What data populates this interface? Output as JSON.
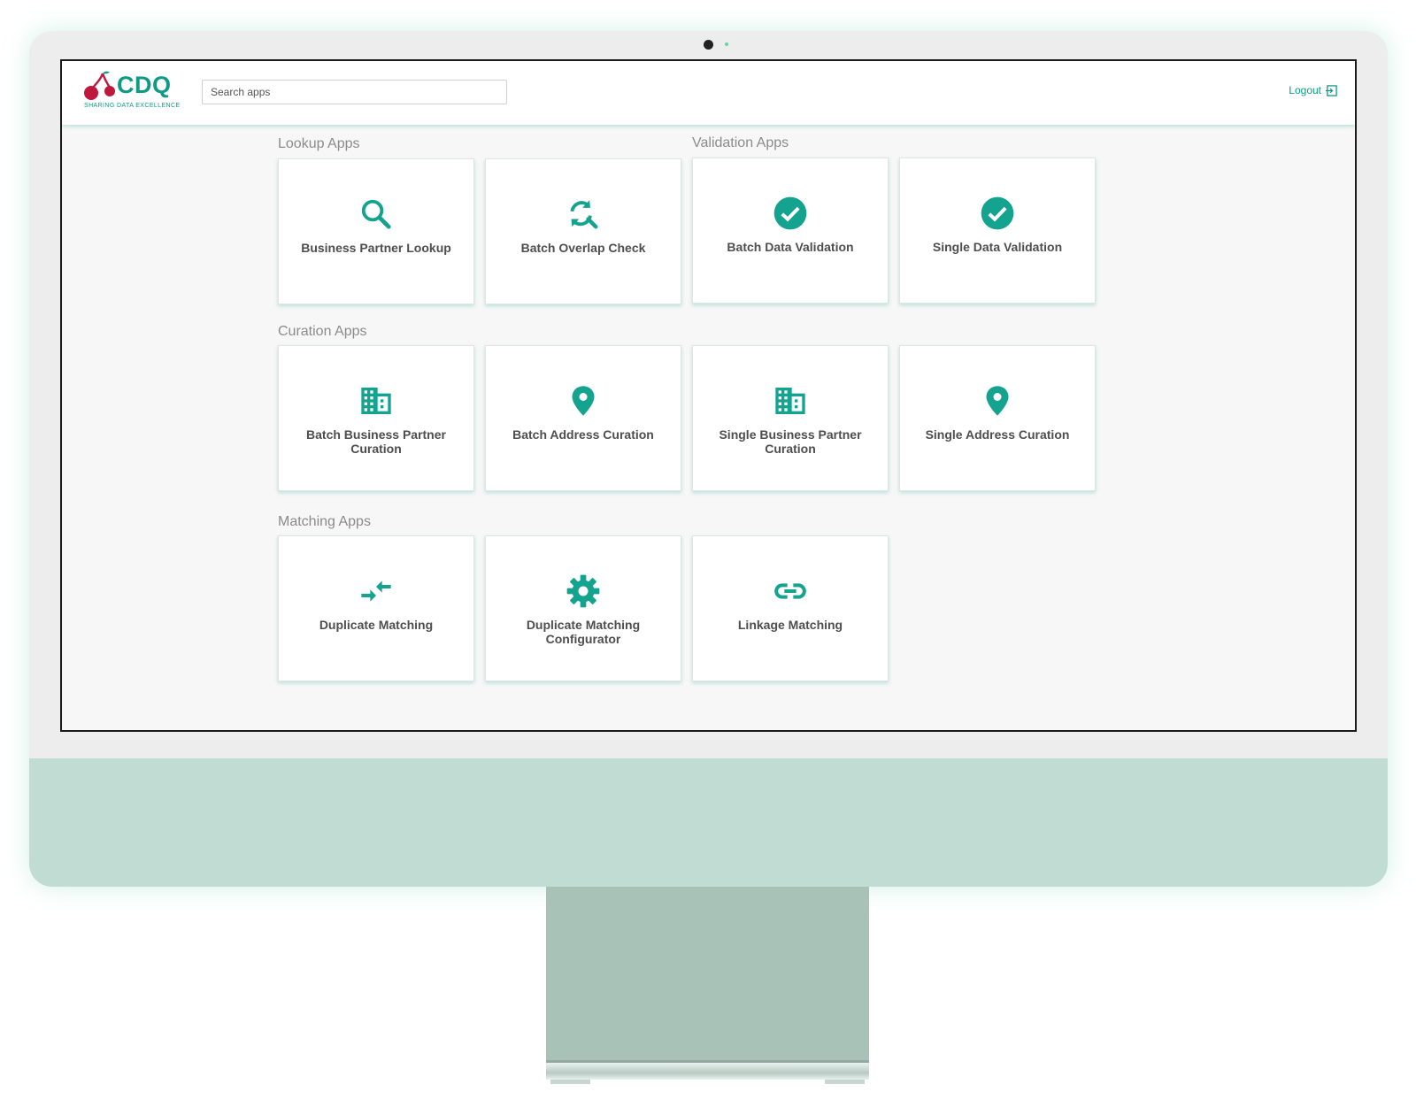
{
  "brand": {
    "name": "CDQ",
    "tagline": "SHARING DATA EXCELLENCE",
    "primary_color": "#0f9a85",
    "accent_color": "#c0173d"
  },
  "header": {
    "search_placeholder": "Search apps",
    "logout_label": "Logout"
  },
  "sections": {
    "lookup": {
      "title": "Lookup Apps",
      "apps": [
        {
          "label": "Business Partner Lookup",
          "icon": "search-icon"
        },
        {
          "label": "Batch Overlap Check",
          "icon": "refresh-search-icon"
        }
      ]
    },
    "validation": {
      "title": "Validation Apps",
      "apps": [
        {
          "label": "Batch Data Validation",
          "icon": "check-circle-icon"
        },
        {
          "label": "Single Data Validation",
          "icon": "check-circle-icon"
        }
      ]
    },
    "curation": {
      "title": "Curation Apps",
      "apps": [
        {
          "label": "Batch Business Partner Curation",
          "icon": "building-icon"
        },
        {
          "label": "Batch Address Curation",
          "icon": "location-pin-icon"
        },
        {
          "label": "Single Business Partner Curation",
          "icon": "building-icon"
        },
        {
          "label": "Single Address Curation",
          "icon": "location-pin-icon"
        }
      ]
    },
    "matching": {
      "title": "Matching Apps",
      "apps": [
        {
          "label": "Duplicate Matching",
          "icon": "merge-arrows-icon"
        },
        {
          "label": "Duplicate Matching Configurator",
          "icon": "gear-icon"
        },
        {
          "label": "Linkage Matching",
          "icon": "link-icon"
        }
      ]
    }
  }
}
